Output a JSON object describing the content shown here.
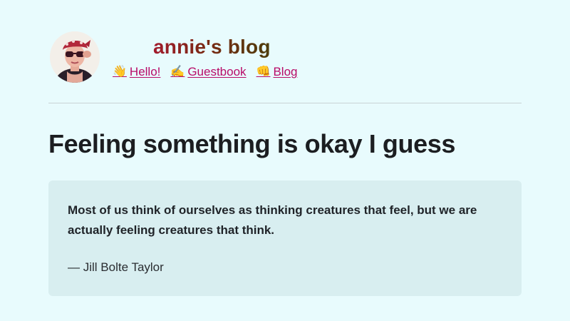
{
  "site": {
    "title": "annie's blog",
    "avatar_alt": "avatar"
  },
  "nav": {
    "items": [
      {
        "emoji": "👋",
        "label": "Hello!"
      },
      {
        "emoji": "✍️",
        "label": "Guestbook"
      },
      {
        "emoji": "👊",
        "label": "Blog"
      }
    ]
  },
  "post": {
    "title": "Feeling something is okay I guess",
    "quote": {
      "text": "Most of us think of ourselves as thinking creatures that feel, but we are actually feeling creatures that think.",
      "author": "— Jill Bolte Taylor"
    }
  },
  "colors": {
    "background": "#e8fbfd",
    "link": "#b80b68",
    "quote_bg": "#d8eef0"
  }
}
